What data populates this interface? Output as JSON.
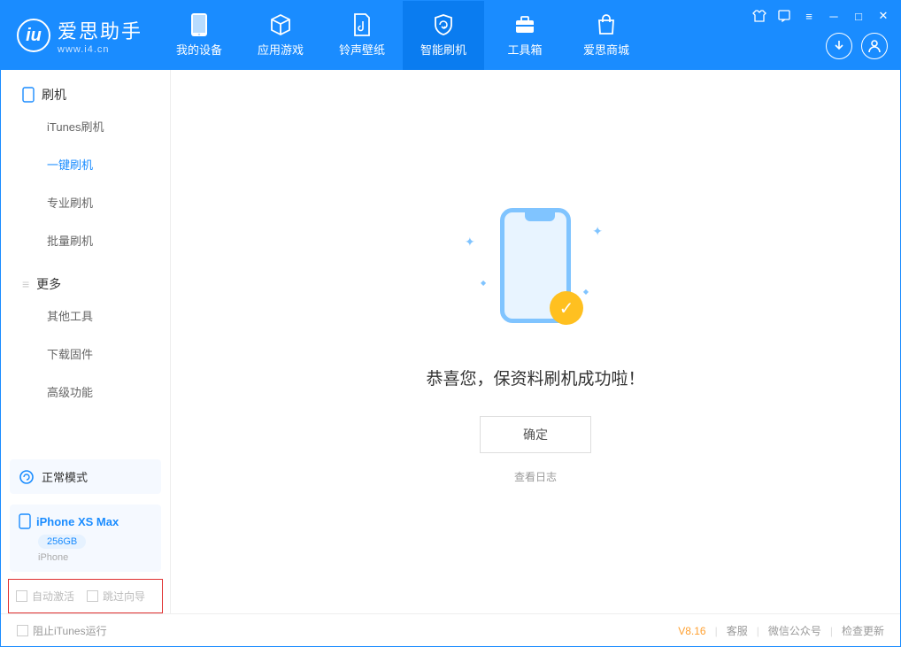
{
  "app": {
    "name": "爱思助手",
    "domain": "www.i4.cn"
  },
  "nav": {
    "items": [
      {
        "label": "我的设备"
      },
      {
        "label": "应用游戏"
      },
      {
        "label": "铃声壁纸"
      },
      {
        "label": "智能刷机"
      },
      {
        "label": "工具箱"
      },
      {
        "label": "爱思商城"
      }
    ]
  },
  "sidebar": {
    "section1": {
      "title": "刷机"
    },
    "items1": [
      {
        "label": "iTunes刷机"
      },
      {
        "label": "一键刷机"
      },
      {
        "label": "专业刷机"
      },
      {
        "label": "批量刷机"
      }
    ],
    "section2": {
      "title": "更多"
    },
    "items2": [
      {
        "label": "其他工具"
      },
      {
        "label": "下载固件"
      },
      {
        "label": "高级功能"
      }
    ],
    "mode": "正常模式",
    "device": {
      "name": "iPhone XS Max",
      "capacity": "256GB",
      "type": "iPhone"
    },
    "options": {
      "auto_activate": "自动激活",
      "skip_guide": "跳过向导"
    }
  },
  "main": {
    "message": "恭喜您，保资料刷机成功啦！",
    "confirm": "确定",
    "view_log": "查看日志"
  },
  "footer": {
    "block_itunes": "阻止iTunes运行",
    "version": "V8.16",
    "support": "客服",
    "wechat": "微信公众号",
    "check_update": "检查更新"
  }
}
